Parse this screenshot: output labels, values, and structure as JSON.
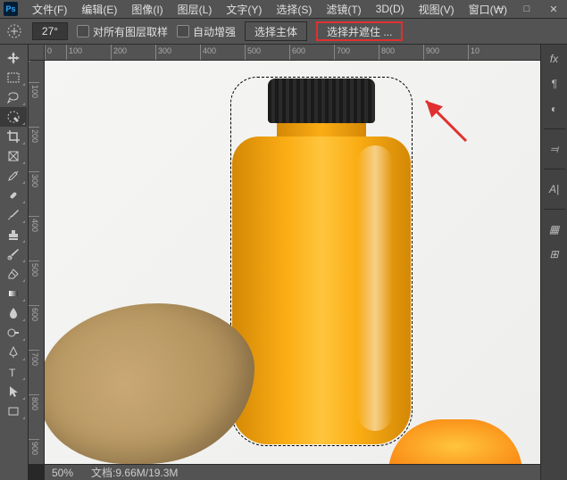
{
  "app_logo": "Ps",
  "menus": {
    "file": "文件(F)",
    "edit": "编辑(E)",
    "image": "图像(I)",
    "layer": "图层(L)",
    "type": "文字(Y)",
    "select": "选择(S)",
    "filter": "滤镜(T)",
    "3d": "3D(D)",
    "view": "视图(V)",
    "window": "窗口(W)"
  },
  "options": {
    "angle": "27°",
    "sample_all_layers": "对所有图层取样",
    "auto_enhance": "自动增强",
    "select_subject": "选择主体",
    "select_mask": "选择并遮住 ..."
  },
  "ruler_h": [
    "0",
    "100",
    "200",
    "300",
    "400",
    "500",
    "600",
    "700",
    "800",
    "900",
    "10"
  ],
  "ruler_v": [
    "100",
    "200",
    "300",
    "400",
    "500",
    "600",
    "700",
    "800",
    "900"
  ],
  "status": {
    "zoom": "50%",
    "doc_label": "文档",
    "doc_info": ":9.66M/19.3M"
  },
  "right": {
    "fx": "fx",
    "pilcrow": "¶",
    "circle": "◐",
    "path": "⫤",
    "letter": "A|",
    "swatches": "▦",
    "library": "⊞"
  }
}
